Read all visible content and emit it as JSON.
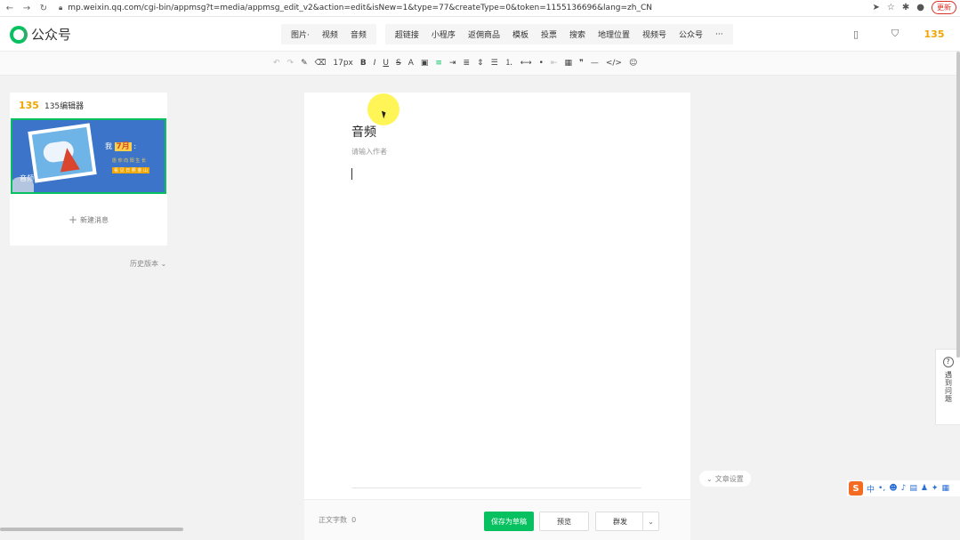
{
  "browser": {
    "url": "mp.weixin.qq.com/cgi-bin/appmsg?t=media/appmsg_edit_v2&action=edit&isNew=1&type=77&createType=0&token=1155136696&lang=zh_CN",
    "update_label": "更新"
  },
  "header": {
    "app_name": "公众号",
    "menu_group1": [
      "图片·",
      "视频",
      "音频"
    ],
    "menu_group2": [
      "超链接",
      "小程序",
      "返佣商品",
      "模板",
      "投票",
      "搜索",
      "地理位置",
      "视频号",
      "公众号",
      "···"
    ],
    "brand_135": "135"
  },
  "format_toolbar": {
    "font_size": "17px",
    "undo": "↶",
    "redo": "↷",
    "bold": "B",
    "italic": "I",
    "underline": "U",
    "strike": "S",
    "font_color": "A",
    "quote": "❞",
    "divider": "—",
    "code": "</>",
    "emoji": "☺"
  },
  "left_panel": {
    "editor_name": "135编辑器",
    "thumb_label": "音频",
    "thumb_month_prefix": "我",
    "thumb_month": "7月",
    "thumb_line1": "愿 你 向 阳 生 长 ",
    "thumb_line2": "看 见 日 照 金 山",
    "new_message": "新建消息",
    "history": "历史版本 ⌄"
  },
  "editor": {
    "title": "音频",
    "author_placeholder": "请输入作者"
  },
  "bottom": {
    "word_count_label": "正文字数",
    "word_count": "0",
    "save_draft": "保存为草稿",
    "preview": "预览",
    "publish": "群发"
  },
  "side": {
    "article_settings": "文章设置",
    "help": "遇到问题"
  },
  "ime": {
    "s": "S",
    "mode": "中"
  },
  "colors": {
    "brand_green": "#07c160",
    "thumb_blue": "#3b74c8"
  }
}
